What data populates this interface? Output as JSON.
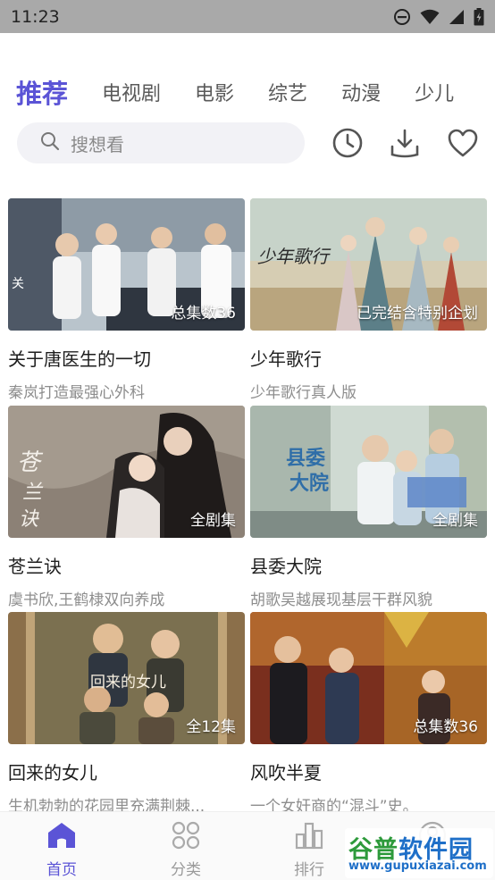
{
  "status_bar": {
    "time": "11:23"
  },
  "tabs": [
    {
      "label": "推荐",
      "active": true
    },
    {
      "label": "电视剧",
      "active": false
    },
    {
      "label": "电影",
      "active": false
    },
    {
      "label": "综艺",
      "active": false
    },
    {
      "label": "动漫",
      "active": false
    },
    {
      "label": "少儿",
      "active": false
    }
  ],
  "search": {
    "placeholder": "搜想看"
  },
  "toolbar_icons": [
    "history-icon",
    "download-icon",
    "favorite-icon"
  ],
  "accent_color": "#5b54d6",
  "cards": [
    {
      "title": "关于唐医生的一切",
      "subtitle": "秦岚打造最强心外科",
      "badge": "总集数36"
    },
    {
      "title": "少年歌行",
      "subtitle": "少年歌行真人版",
      "badge": "已完结含特别企划"
    },
    {
      "title": "苍兰诀",
      "subtitle": "虞书欣,王鹤棣双向养成",
      "badge": "全剧集"
    },
    {
      "title": "县委大院",
      "subtitle": "胡歌吴越展现基层干群风貌",
      "badge": "全剧集"
    },
    {
      "title": "回来的女儿",
      "subtitle": "生机勃勃的花园里充满荆棘...",
      "badge": "全12集"
    },
    {
      "title": "风吹半夏",
      "subtitle": "一个女奸商的“混斗”史。",
      "badge": "总集数36"
    }
  ],
  "bottom_nav": [
    {
      "label": "首页",
      "icon": "home-icon",
      "active": true
    },
    {
      "label": "分类",
      "icon": "category-icon",
      "active": false
    },
    {
      "label": "排行",
      "icon": "ranking-icon",
      "active": false
    },
    {
      "label": "",
      "icon": "profile-icon",
      "active": false
    }
  ],
  "watermark": {
    "main_a": "谷普",
    "main_b": "软件园",
    "url": "www.gupuxiazai.com"
  }
}
